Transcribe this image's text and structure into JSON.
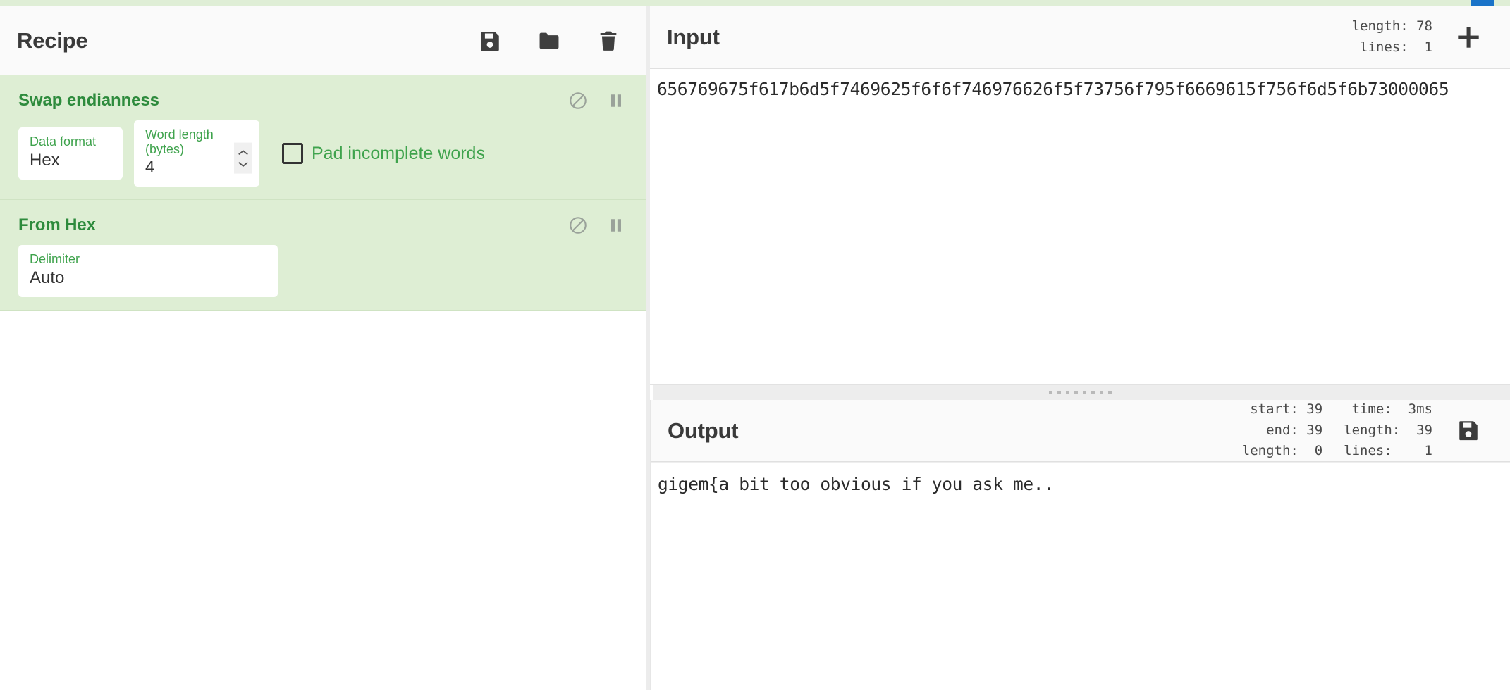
{
  "app": {
    "name": "CyberChef",
    "accent_green": "#3fa34d",
    "op_bg": "#deeed4",
    "panel_bg": "#fafafa",
    "blue_chip": "#1a73c8"
  },
  "recipe": {
    "title": "Recipe",
    "toolbar": [
      {
        "name": "save-recipe-icon",
        "label": "Save recipe"
      },
      {
        "name": "load-recipe-icon",
        "label": "Load recipe"
      },
      {
        "name": "clear-recipe-icon",
        "label": "Clear recipe"
      }
    ],
    "operations": [
      {
        "name": "Swap endianness",
        "disable_label": "Disable operation",
        "breakpoint_label": "Set breakpoint",
        "args": [
          {
            "label": "Data format",
            "value": "Hex",
            "type": "select"
          },
          {
            "label": "Word length (bytes)",
            "value": "4",
            "type": "number"
          }
        ],
        "checkbox": {
          "label": "Pad incomplete words",
          "checked": false
        }
      },
      {
        "name": "From Hex",
        "disable_label": "Disable operation",
        "breakpoint_label": "Set breakpoint",
        "args": [
          {
            "label": "Delimiter",
            "value": "Auto",
            "type": "select"
          }
        ],
        "checkbox": null
      }
    ]
  },
  "input": {
    "title": "Input",
    "stats": {
      "length_label": "length: 78",
      "lines_label": "lines:  1"
    },
    "add_tab_label": "+",
    "text": "656769675f617b6d5f7469625f6f6f746976626f5f73756f795f6669615f756f6d5f6b73000065"
  },
  "output": {
    "title": "Output",
    "stats_left": {
      "start_label": "start: 39",
      "end_label": "end: 39",
      "length_label": "length:  0"
    },
    "stats_right": {
      "time_label": "time:  3ms",
      "length_label": "length:  39",
      "lines_label": "lines:    1"
    },
    "save_label": "Save output to file",
    "text": "gigem{a_bit_too_obvious_if_you_ask_me.."
  }
}
